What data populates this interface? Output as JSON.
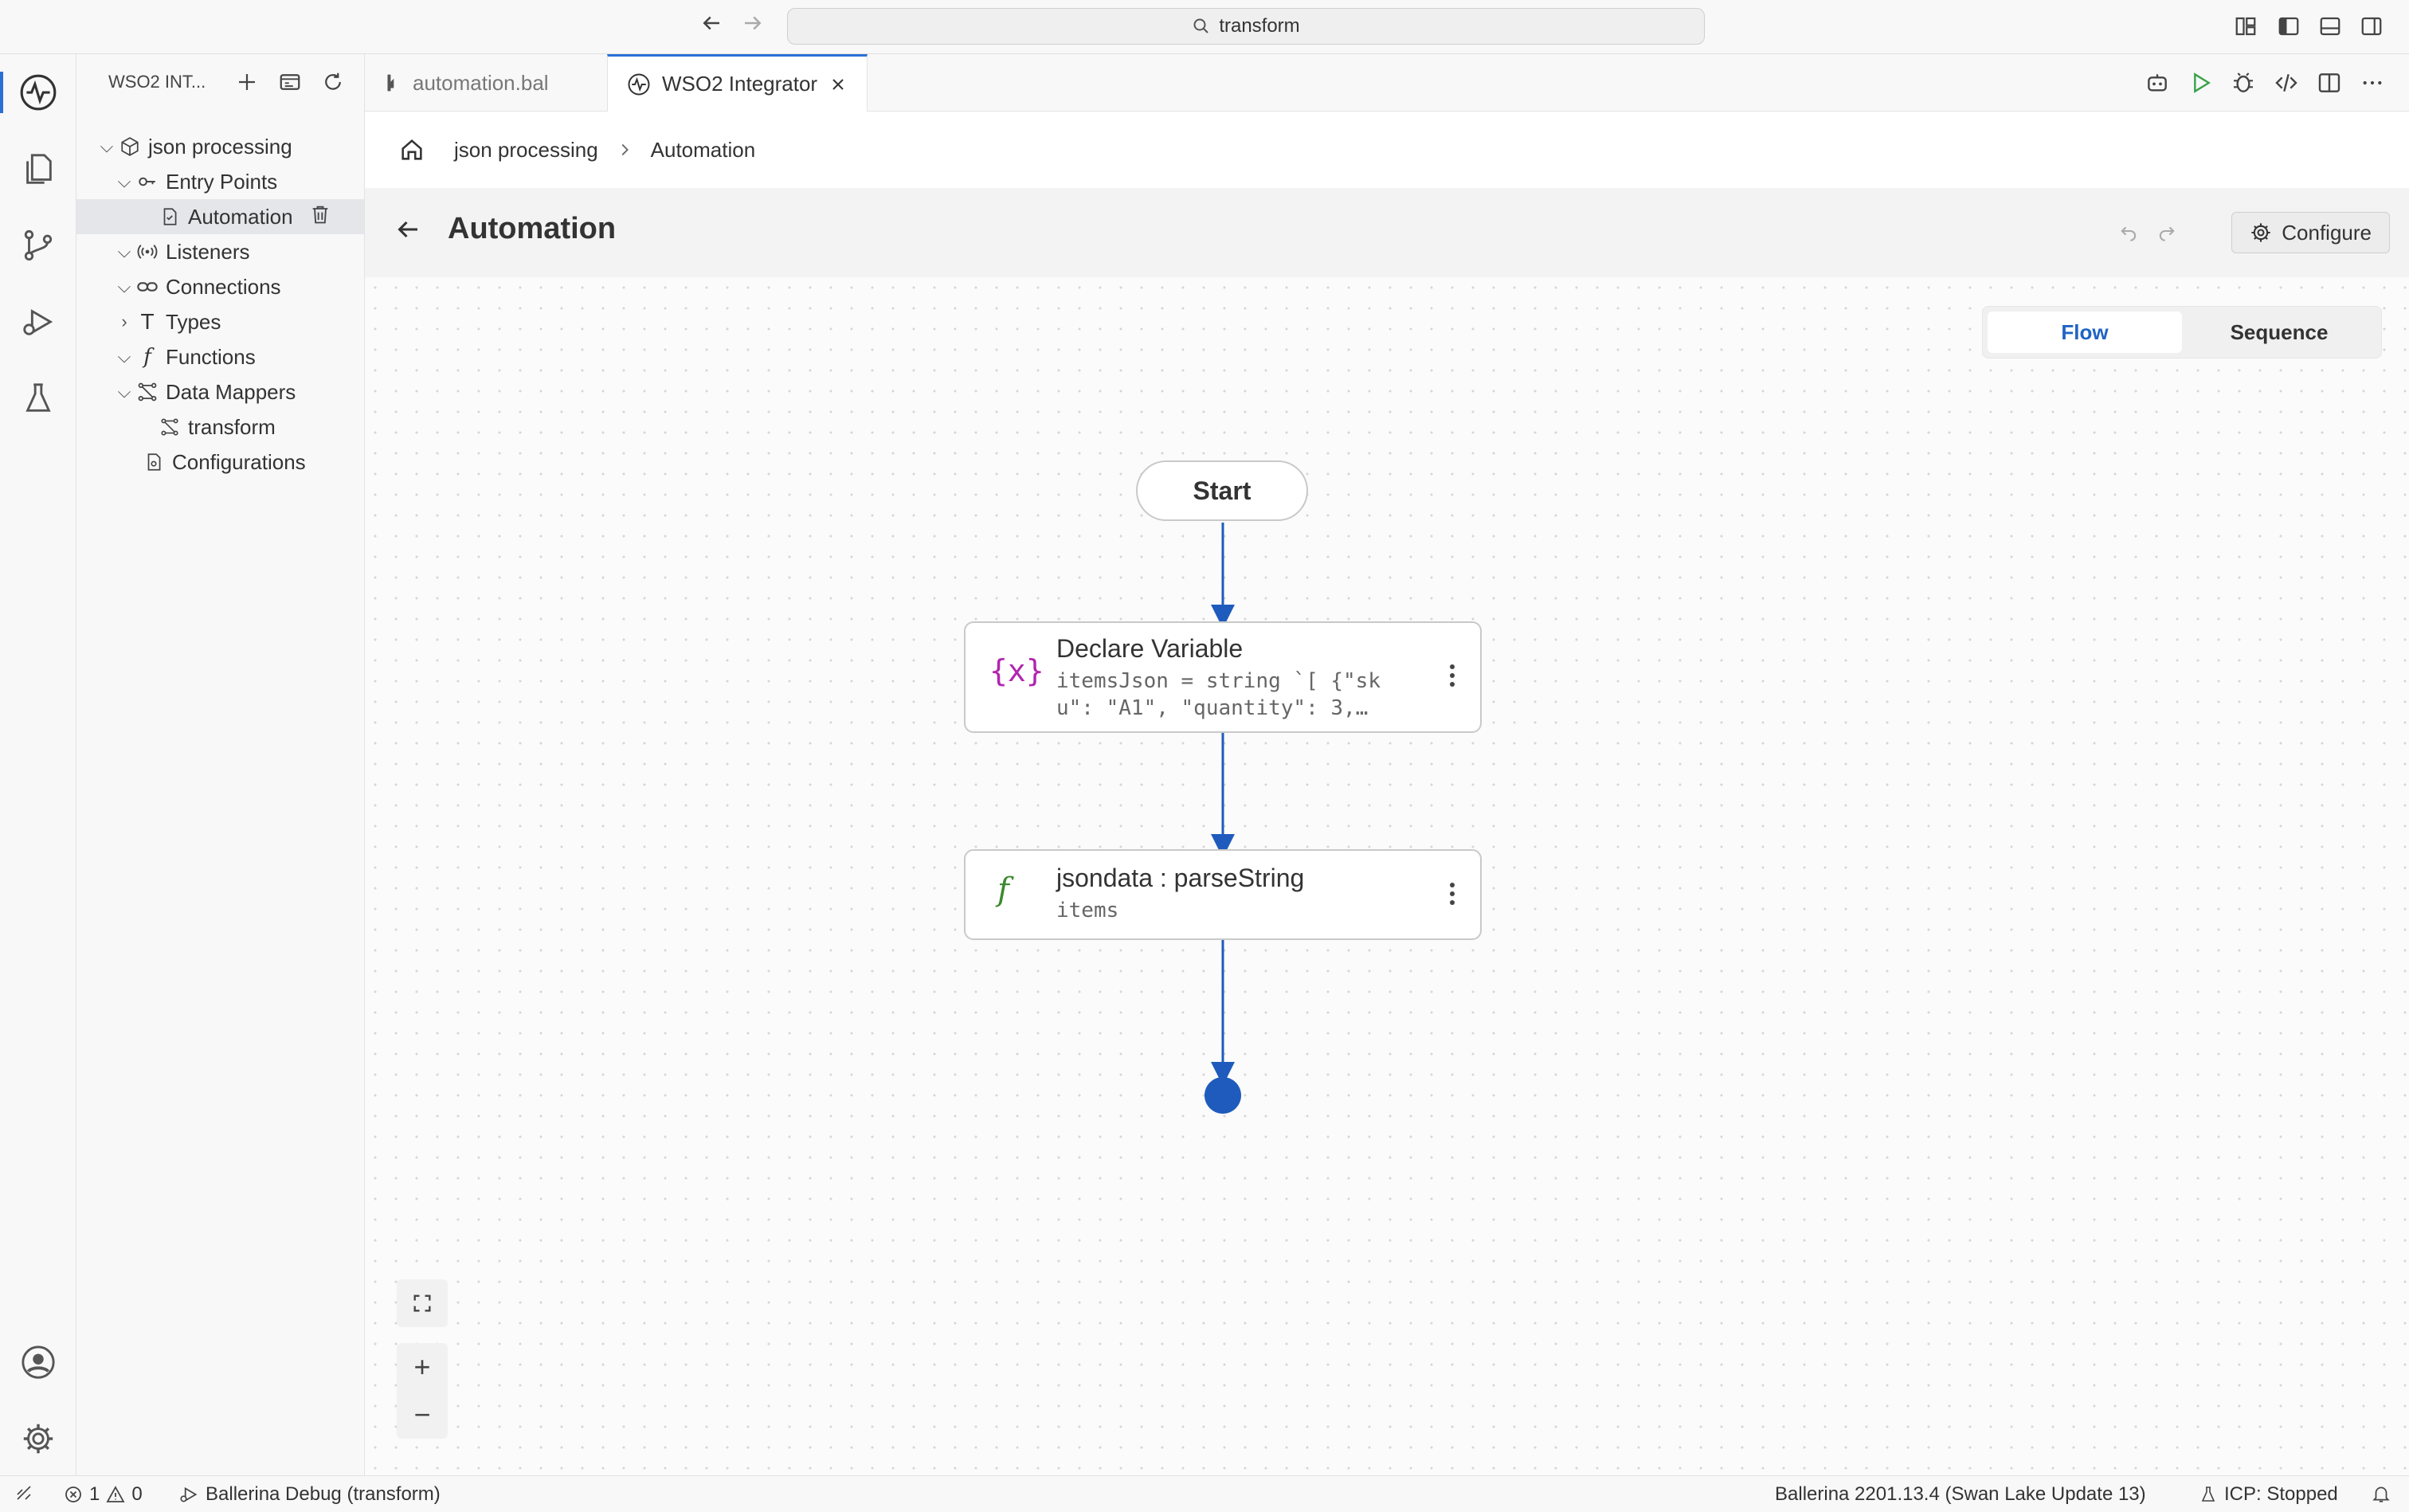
{
  "titlebar": {
    "search_text": "transform"
  },
  "sidebar": {
    "title": "WSO2 INT...",
    "tree": {
      "project": "json processing",
      "entry_points": "Entry Points",
      "automation": "Automation",
      "listeners": "Listeners",
      "connections": "Connections",
      "types": "Types",
      "functions": "Functions",
      "data_mappers": "Data Mappers",
      "transform": "transform",
      "configurations": "Configurations"
    }
  },
  "tabs": [
    {
      "label": "automation.bal",
      "active": false
    },
    {
      "label": "WSO2 Integrator",
      "active": true
    }
  ],
  "breadcrumb": {
    "project": "json processing",
    "current": "Automation"
  },
  "header": {
    "title": "Automation",
    "configure_label": "Configure"
  },
  "view_toggle": {
    "flow": "Flow",
    "sequence": "Sequence",
    "selected": "Flow"
  },
  "flow": {
    "start_label": "Start",
    "nodes": [
      {
        "title": "Declare Variable",
        "line1": "itemsJson = string `[ {\"sk",
        "line2": "u\": \"A1\", \"quantity\": 3,…",
        "icon": "variable-icon"
      },
      {
        "title": "jsondata : parseString",
        "line1": "items",
        "icon": "function-icon"
      }
    ]
  },
  "zoom": {
    "zoom_in": "+",
    "zoom_out": "−"
  },
  "statusbar": {
    "errors": "1",
    "warnings": "0",
    "debug": "Ballerina Debug (transform)",
    "version": "Ballerina 2201.13.4 (Swan Lake Update 13)",
    "icp": "ICP: Stopped"
  },
  "colors": {
    "accent": "#2b6fd6",
    "edge": "#1f5bbd",
    "variable_icon": "#b025b0",
    "function_icon": "#3c8a2e"
  }
}
